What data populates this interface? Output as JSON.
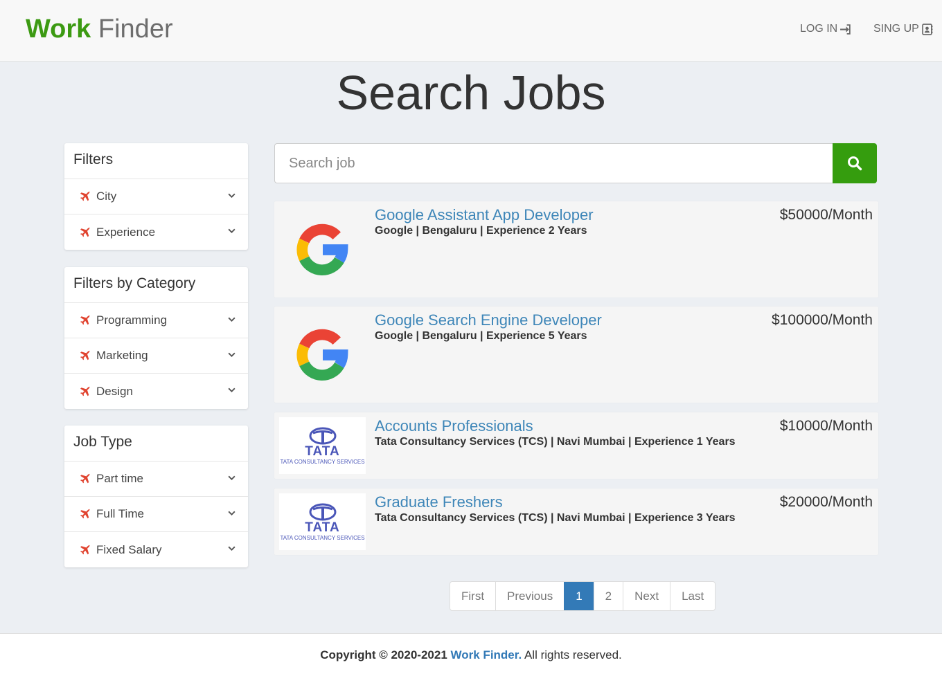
{
  "nav": {
    "brand_strong": "Work",
    "brand_light": "Finder",
    "login_label": "LOG IN",
    "signup_label": "SING UP"
  },
  "page_title": "Search Jobs",
  "filters": {
    "title": "Filters",
    "items": [
      "City",
      "Experience"
    ]
  },
  "categories": {
    "title": "Filters by Category",
    "items": [
      "Programming",
      "Marketing",
      "Design"
    ]
  },
  "job_type": {
    "title": "Job Type",
    "items": [
      "Part time",
      "Full Time",
      "Fixed Salary"
    ]
  },
  "search": {
    "placeholder": "Search job",
    "value": ""
  },
  "jobs": [
    {
      "title": "Google Assistant App Developer",
      "meta": "Google | Bengaluru | Experience 2 Years",
      "salary": "$50000/Month",
      "logo": "google-logo"
    },
    {
      "title": "Google Search Engine Developer",
      "meta": "Google | Bengaluru | Experience 5 Years",
      "salary": "$100000/Month",
      "logo": "google-logo"
    },
    {
      "title": "Accounts Professionals",
      "meta": "Tata Consultancy Services (TCS) | Navi Mumbai | Experience 1 Years",
      "salary": "$10000/Month",
      "logo": "tata-logo"
    },
    {
      "title": "Graduate Freshers",
      "meta": "Tata Consultancy Services (TCS) | Navi Mumbai | Experience 3 Years",
      "salary": "$20000/Month",
      "logo": "tata-logo"
    }
  ],
  "tata_logo": {
    "word": "TATA",
    "sub": "TATA CONSULTANCY SERVICES"
  },
  "pagination": {
    "first": "First",
    "previous": "Previous",
    "pages": [
      "1",
      "2"
    ],
    "active_page": "1",
    "next": "Next",
    "last": "Last"
  },
  "footer": {
    "copyright": "Copyright © 2020-2021",
    "brand": "Work Finder.",
    "rights": "All rights reserved."
  },
  "colors": {
    "brand_green": "#3c9a12",
    "search_button": "#359d0e",
    "link_blue": "#3e86b8",
    "active_page": "#337ab7",
    "icon_red": "#e0432f"
  }
}
